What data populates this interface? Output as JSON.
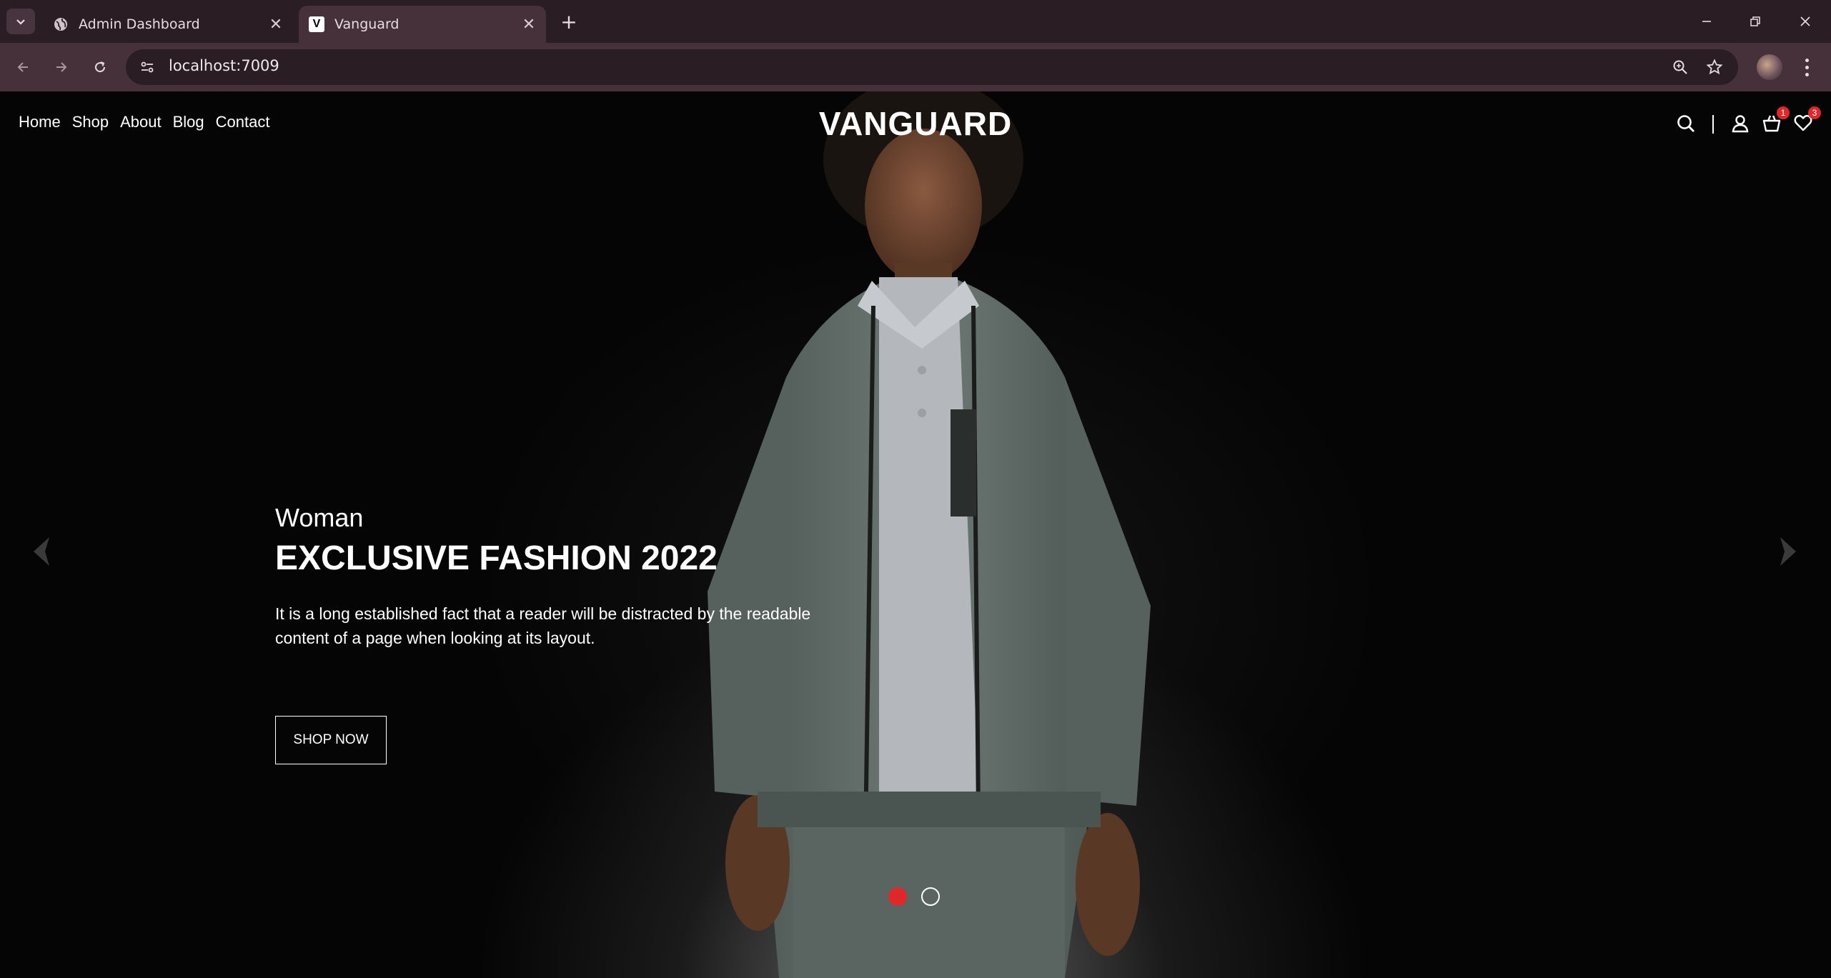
{
  "browser": {
    "tabs": [
      {
        "title": "Admin Dashboard",
        "icon": "globe-icon",
        "active": false
      },
      {
        "title": "Vanguard",
        "icon": "vanguard-favicon",
        "active": true
      }
    ],
    "favicon_letter": "V",
    "url": "localhost:7009"
  },
  "site": {
    "nav": [
      "Home",
      "Shop",
      "About",
      "Blog",
      "Contact"
    ],
    "logo": "VANGUARD",
    "cart_count": "1",
    "wishlist_count": "3"
  },
  "hero": {
    "subtitle": "Woman",
    "title": "EXCLUSIVE FASHION 2022",
    "description": "It is a long established fact that a reader will be distracted by the readable content of a page when looking at its layout.",
    "button": "SHOP NOW",
    "slides_total": 2,
    "slide_active": 1
  },
  "colors": {
    "accent": "#e0282a",
    "chrome_dark": "#2b1d24",
    "chrome_light": "#46313b"
  }
}
